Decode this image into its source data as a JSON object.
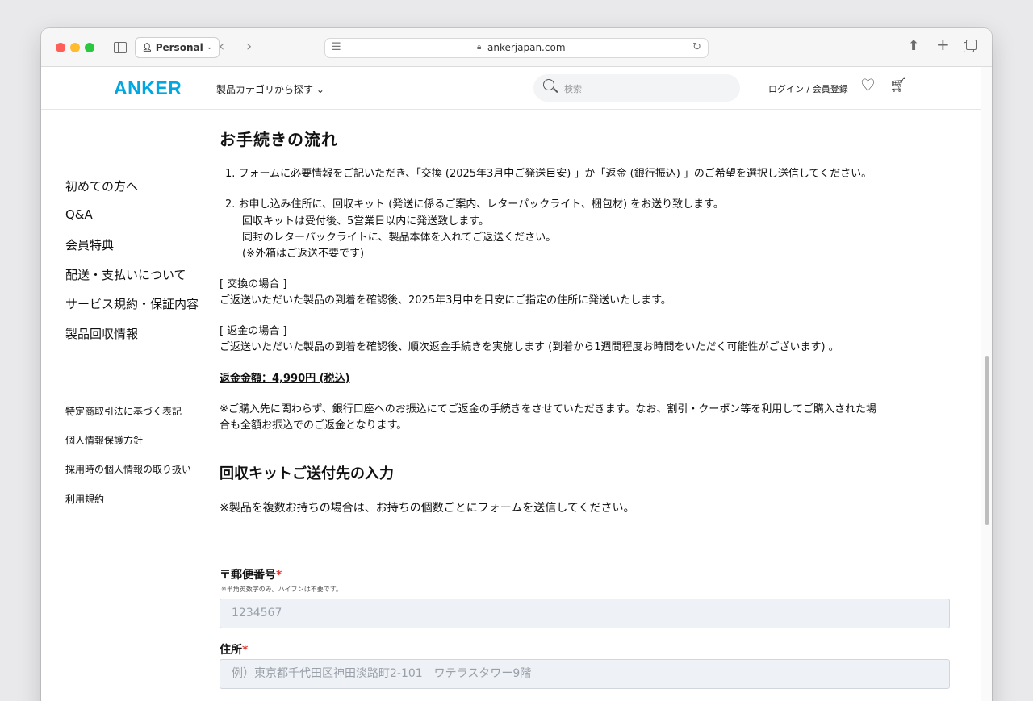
{
  "browser": {
    "profile_label": "Personal",
    "url": "ankerjapan.com"
  },
  "header": {
    "logo": "ANKER",
    "category_menu": "製品カテゴリから探す ⌄",
    "search_placeholder": "検索",
    "login": "ログイン / 会員登録"
  },
  "sidebar": {
    "items": [
      "初めての方へ",
      "Q&A",
      "会員特典",
      "配送・支払いについて",
      "サービス規約・保証内容",
      "製品回収情報"
    ],
    "links": [
      "特定商取引法に基づく表記",
      "個人情報保護方針",
      "採用時の個人情報の取り扱い",
      "利用規約"
    ]
  },
  "main": {
    "title": "お手続きの流れ",
    "step1": "1.  フォームに必要情報をご記いただき、「交換 (2025年3月中ご発送目安) 」か「返金 (銀行振込) 」のご希望を選択し送信してください。",
    "step2_line1": "2.  お申し込み住所に、回収キット (発送に係るご案内、レターパックライト、梱包材) をお送り致します。",
    "step2_line2": "回収キットは受付後、5営業日以内に発送致します。",
    "step2_line3": "同封のレターパックライトに、製品本体を入れてご返送ください。",
    "step2_line4": "(※外箱はご返送不要です)",
    "exchange_heading": "[ 交換の場合 ]",
    "exchange_text": "ご返送いただいた製品の到着を確認後、2025年3月中を目安にご指定の住所に発送いたします。",
    "refund_heading": "[ 返金の場合 ]",
    "refund_text": "ご返送いただいた製品の到着を確認後、順次返金手続きを実施します (到着から1週間程度お時間をいただく可能性がございます) 。",
    "refund_amount": "返金金額：4,990円 (税込)",
    "note_line1": "※ご購入先に関わらず、銀行口座へのお振込にてご返金の手続きをさせていただきます。なお、割引・クーポン等を利用してご購入された場",
    "note_line2": "合も全額お振込でのご返金となります。",
    "form_title": "回収キットご送付先の入力",
    "form_note": "※製品を複数お持ちの場合は、お持ちの個数ごとにフォームを送信してください。"
  },
  "form": {
    "postal_label": "〒郵便番号",
    "required_mark": "*",
    "postal_hint": "※半角英数字のみ。ハイフンは不要です。",
    "postal_placeholder": "1234567",
    "address_label": "住所",
    "address_placeholder": "例）東京都千代田区神田淡路町2-101　ワテラスタワー9階"
  },
  "colors": {
    "brand": "#00a7e1",
    "required": "#e53935"
  }
}
